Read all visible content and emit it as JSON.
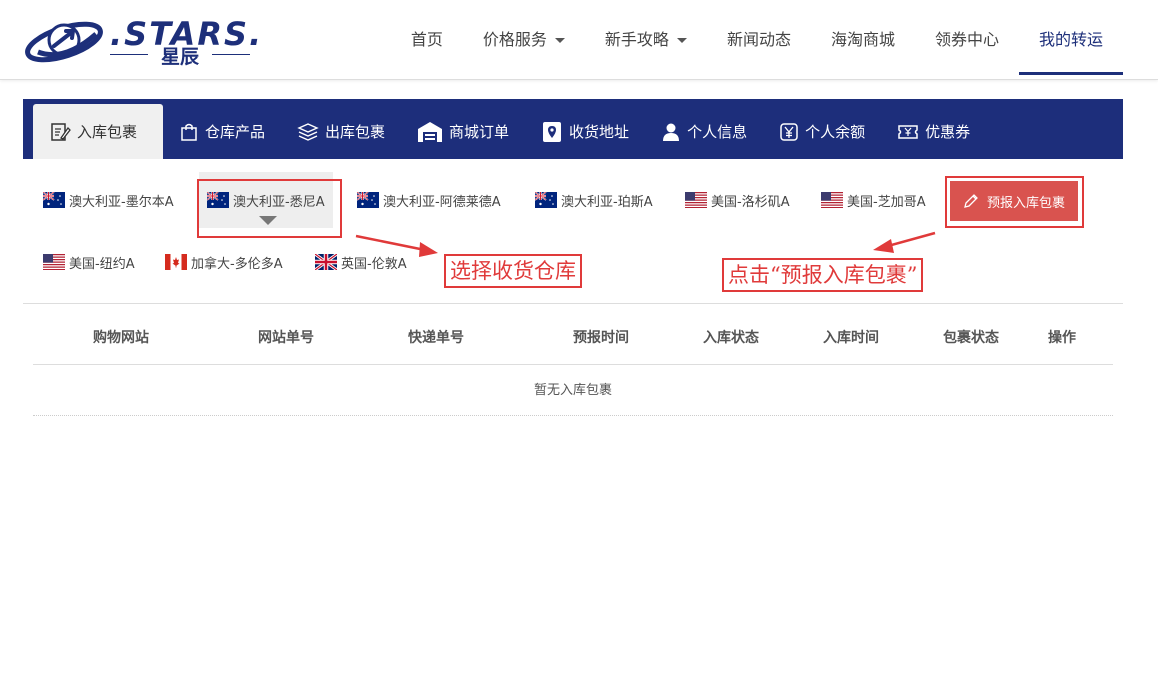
{
  "logo": {
    "word": ".STARS.",
    "sub": "星辰"
  },
  "nav": [
    {
      "label": "首页",
      "dropdown": false,
      "active": false
    },
    {
      "label": "价格服务",
      "dropdown": true,
      "active": false
    },
    {
      "label": "新手攻略",
      "dropdown": true,
      "active": false
    },
    {
      "label": "新闻动态",
      "dropdown": false,
      "active": false
    },
    {
      "label": "海淘商城",
      "dropdown": false,
      "active": false
    },
    {
      "label": "领券中心",
      "dropdown": false,
      "active": false
    },
    {
      "label": "我的转运",
      "dropdown": false,
      "active": true
    }
  ],
  "tabs": [
    {
      "label": "入库包裹",
      "icon": "edit-doc-icon",
      "active": true
    },
    {
      "label": "仓库产品",
      "icon": "bag-icon",
      "active": false
    },
    {
      "label": "出库包裹",
      "icon": "layers-icon",
      "active": false
    },
    {
      "label": "商城订单",
      "icon": "warehouse-icon",
      "active": false
    },
    {
      "label": "收货地址",
      "icon": "location-icon",
      "active": false
    },
    {
      "label": "个人信息",
      "icon": "user-icon",
      "active": false
    },
    {
      "label": "个人余额",
      "icon": "yen-icon",
      "active": false
    },
    {
      "label": "优惠券",
      "icon": "coupon-icon",
      "active": false
    }
  ],
  "warehouses": [
    {
      "label": "澳大利亚-墨尔本A",
      "flag": "au",
      "selected": false
    },
    {
      "label": "澳大利亚-悉尼A",
      "flag": "au",
      "selected": true
    },
    {
      "label": "澳大利亚-阿德莱德A",
      "flag": "au",
      "selected": false
    },
    {
      "label": "澳大利亚-珀斯A",
      "flag": "au",
      "selected": false
    },
    {
      "label": "美国-洛杉矶A",
      "flag": "us",
      "selected": false
    },
    {
      "label": "美国-芝加哥A",
      "flag": "us",
      "selected": false
    },
    {
      "label": "美国-纽约A",
      "flag": "us",
      "selected": false
    },
    {
      "label": "加拿大-多伦多A",
      "flag": "ca",
      "selected": false
    },
    {
      "label": "英国-伦敦A",
      "flag": "uk",
      "selected": false
    }
  ],
  "preregister_button": "预报入库包裹",
  "annotations": {
    "select_warehouse": "选择收货仓库",
    "click_preregister": "点击“预报入库包裹”"
  },
  "table": {
    "columns": [
      "购物网站",
      "网站单号",
      "快递单号",
      "预报时间",
      "入库状态",
      "入库时间",
      "包裹状态",
      "操作"
    ],
    "empty_text": "暂无入库包裹"
  },
  "colors": {
    "brand": "#1d2e7b",
    "button": "#d9534f",
    "annotation": "#e03a3a"
  }
}
